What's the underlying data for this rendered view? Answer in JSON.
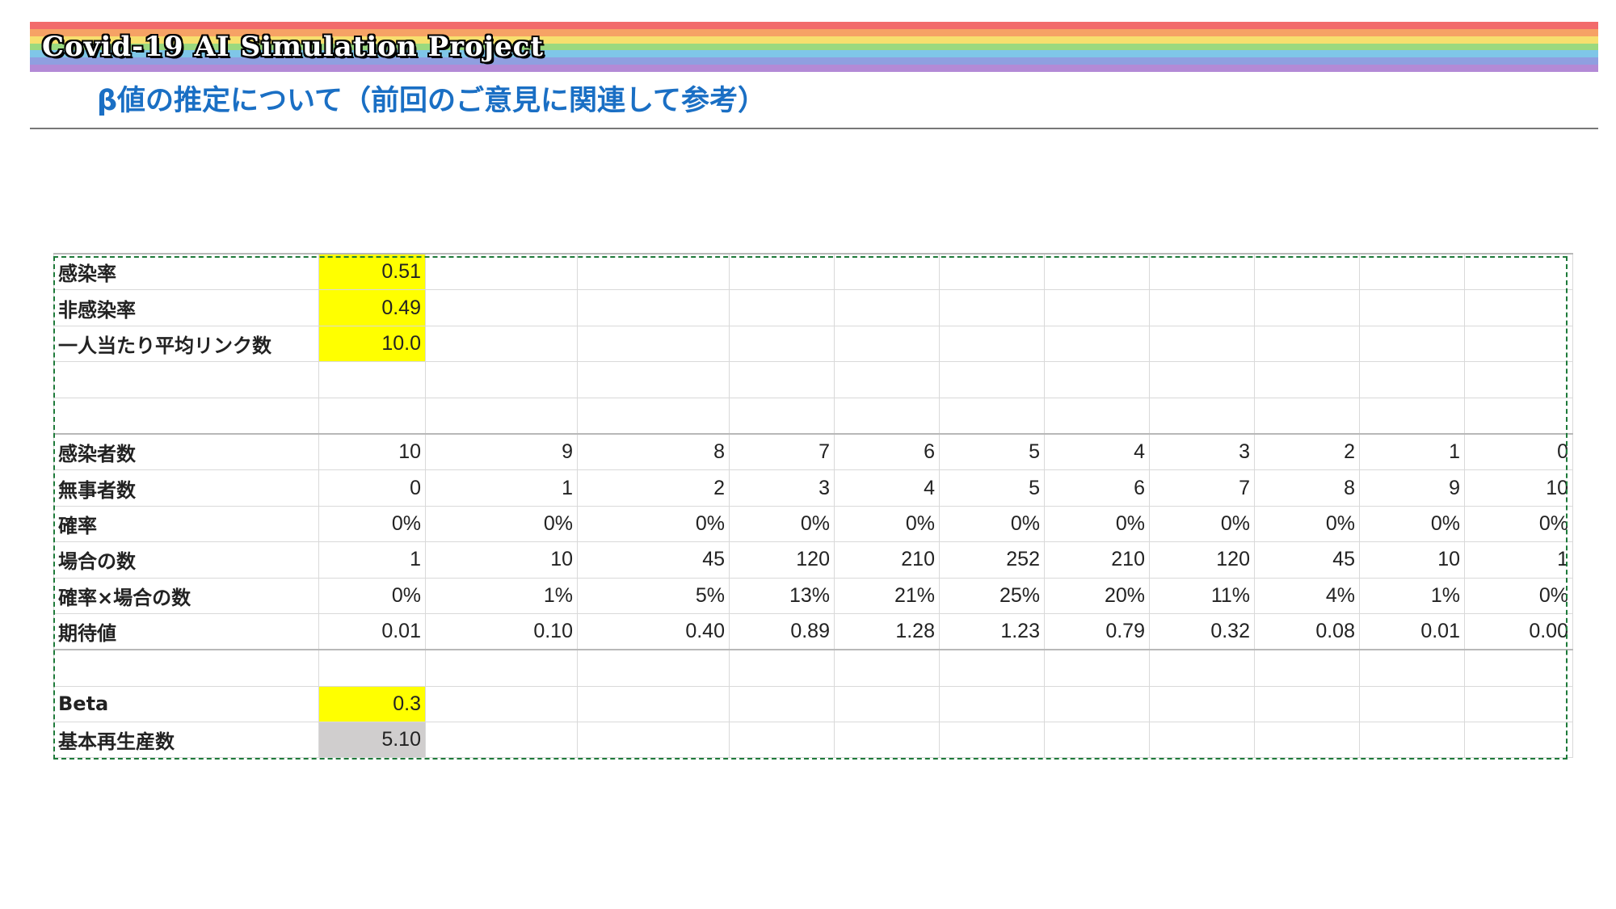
{
  "header": {
    "project_title": "Covid-19 AI Simulation Project",
    "page_title": "β値の推定について（前回のご意見に関連して参考）",
    "rainbow_colors": [
      "#f26b6b",
      "#f6a265",
      "#f7df6e",
      "#9bd97f",
      "#7fc6e8",
      "#8f9fe0",
      "#b38ad6"
    ]
  },
  "sheet": {
    "params": [
      {
        "label": "感染率",
        "value": "0.51"
      },
      {
        "label": "非感染率",
        "value": "0.49"
      },
      {
        "label": "一人当たり平均リンク数",
        "value": "10.0"
      }
    ],
    "rows": [
      {
        "label": "感染者数",
        "values": [
          "10",
          "9",
          "8",
          "7",
          "6",
          "5",
          "4",
          "3",
          "2",
          "1",
          "0"
        ]
      },
      {
        "label": "無事者数",
        "values": [
          "0",
          "1",
          "2",
          "3",
          "4",
          "5",
          "6",
          "7",
          "8",
          "9",
          "10"
        ]
      },
      {
        "label": "確率",
        "values": [
          "0%",
          "0%",
          "0%",
          "0%",
          "0%",
          "0%",
          "0%",
          "0%",
          "0%",
          "0%",
          "0%"
        ]
      },
      {
        "label": "場合の数",
        "values": [
          "1",
          "10",
          "45",
          "120",
          "210",
          "252",
          "210",
          "120",
          "45",
          "10",
          "1"
        ]
      },
      {
        "label": "確率×場合の数",
        "values": [
          "0%",
          "1%",
          "5%",
          "13%",
          "21%",
          "25%",
          "20%",
          "11%",
          "4%",
          "1%",
          "0%"
        ]
      },
      {
        "label": "期待値",
        "values": [
          "0.01",
          "0.10",
          "0.40",
          "0.89",
          "1.28",
          "1.23",
          "0.79",
          "0.32",
          "0.08",
          "0.01",
          "0.00"
        ]
      }
    ],
    "beta": {
      "label": "Beta",
      "value": "0.3"
    },
    "r0": {
      "label": "基本再生産数",
      "value": "5.10"
    },
    "highlight_colors": {
      "input": "#ffff00",
      "result": "#d0cece",
      "selection": "#1e7a3a"
    }
  }
}
